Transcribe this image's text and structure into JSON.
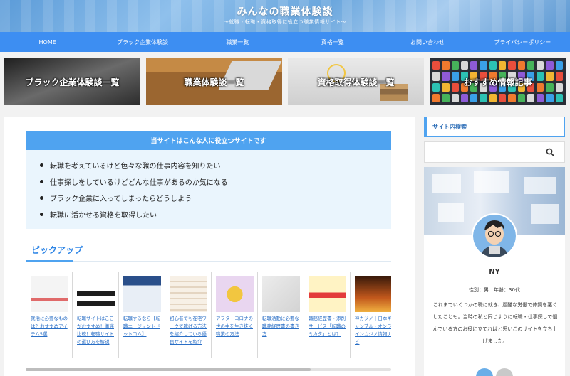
{
  "header": {
    "title": "みんなの職業体験談",
    "subtitle": "〜就職・転職・資格取得に役立つ職業情報サイト〜"
  },
  "nav": [
    {
      "label": "HOME"
    },
    {
      "label": "ブラック企業体験談"
    },
    {
      "label": "職業一覧"
    },
    {
      "label": "資格一覧"
    },
    {
      "label": "お問い合わせ"
    },
    {
      "label": "プライバシーポリシー"
    }
  ],
  "tiles": [
    {
      "label": "ブラック企業体験談一覧"
    },
    {
      "label": "職業体験談一覧"
    },
    {
      "label": "資格取得体験談一覧"
    },
    {
      "label": "おすすめ情報記事"
    }
  ],
  "target_box": {
    "title": "当サイトはこんな人に役立つサイトです",
    "items": [
      "転職を考えているけど色々な職の仕事内容を知りたい",
      "仕事探しをしているけどどんな仕事があるのか気になる",
      "ブラック企業に入ってしまったらどうしよう",
      "転職に活かせる資格を取得したい"
    ]
  },
  "pickup": {
    "title": "ピックアップ",
    "cards": [
      {
        "text": "就活に必要なものは？おすすめアイテム5選"
      },
      {
        "text": "転職サイトはここがおすすめ！徹底比較！転職サイトの選び方を解説"
      },
      {
        "text": "転職するなら【転職エージェントドットコム】"
      },
      {
        "text": "初心者でも在宅ワークで稼げる方法を紹介している優良サイトを紹介"
      },
      {
        "text": "アフターコロナの世の中を生き抜く職業の方法"
      },
      {
        "text": "転職活動に必要な職務経歴書の書き方"
      },
      {
        "text": "職務経歴書・添削サービス「転職のミカタ」とは？"
      },
      {
        "text": "神カジノ｜日本ギャンブル・オンラインカジノ情報ナビ"
      }
    ]
  },
  "sidebar": {
    "search_title": "サイト内検索",
    "profile": {
      "name": "NY",
      "meta": "性別：男　年齢：30代",
      "bio": "これまでいくつかの職に就き、過酷な労働で体調を悪くしたことも。当時の私と同じように転職・仕事探しで悩んでいる方のお役に立てればと思いこのサイトを立ち上げました。"
    }
  },
  "colors": {
    "nav_bg": "#3d8ef2",
    "accent": "#4fa3f0",
    "link": "#2a6fc6",
    "box_bg": "#eaf5fd"
  }
}
